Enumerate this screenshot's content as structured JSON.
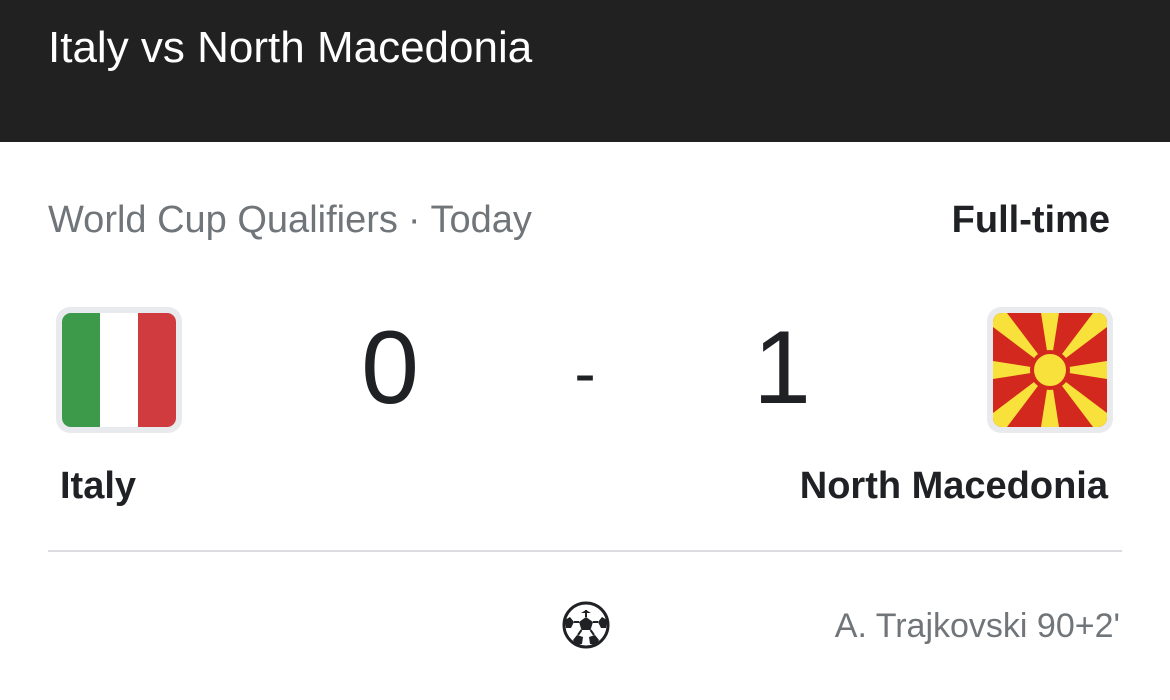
{
  "header": {
    "title": "Italy vs North Macedonia"
  },
  "match": {
    "competition": "World Cup Qualifiers",
    "separator": "·",
    "date": "Today",
    "status": "Full-time",
    "score_separator": "-",
    "home": {
      "name": "Italy",
      "score": "0",
      "flag_icon": "italy-flag-icon",
      "flag_colors": [
        "#3d9a4a",
        "#ffffff",
        "#cf3b3e"
      ]
    },
    "away": {
      "name": "North Macedonia",
      "score": "1",
      "flag_icon": "north-macedonia-flag-icon",
      "flag_colors": [
        "#d2281e",
        "#f8e13b"
      ]
    }
  },
  "goals": [
    {
      "icon": "soccer-ball-icon",
      "scorer": "A. Trajkovski 90+2'"
    }
  ],
  "colors": {
    "header_bg": "#212121",
    "secondary_text": "#70757a",
    "primary_text": "#202124"
  }
}
